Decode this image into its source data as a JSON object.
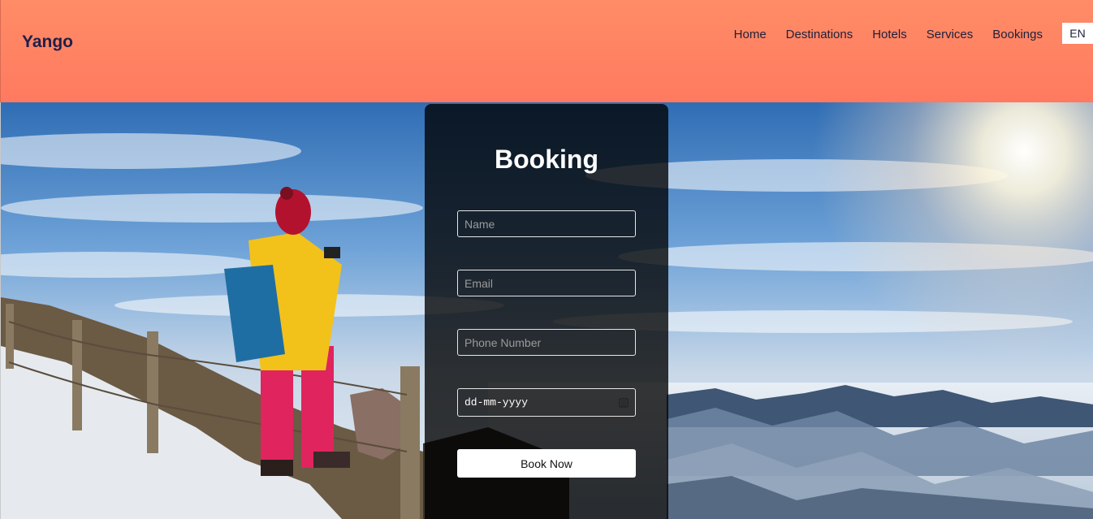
{
  "header": {
    "logo": "Yango",
    "nav": [
      "Home",
      "Destinations",
      "Hotels",
      "Services",
      "Bookings"
    ],
    "language": "EN"
  },
  "booking": {
    "title": "Booking",
    "name_placeholder": "Name",
    "email_placeholder": "Email",
    "phone_placeholder": "Phone Number",
    "date_placeholder": "dd-mm-yyyy",
    "button_label": "Book Now"
  },
  "colors": {
    "header": "#ff8066",
    "logo": "#1f1f4b",
    "card": "#000000",
    "button": "#ffffff"
  }
}
